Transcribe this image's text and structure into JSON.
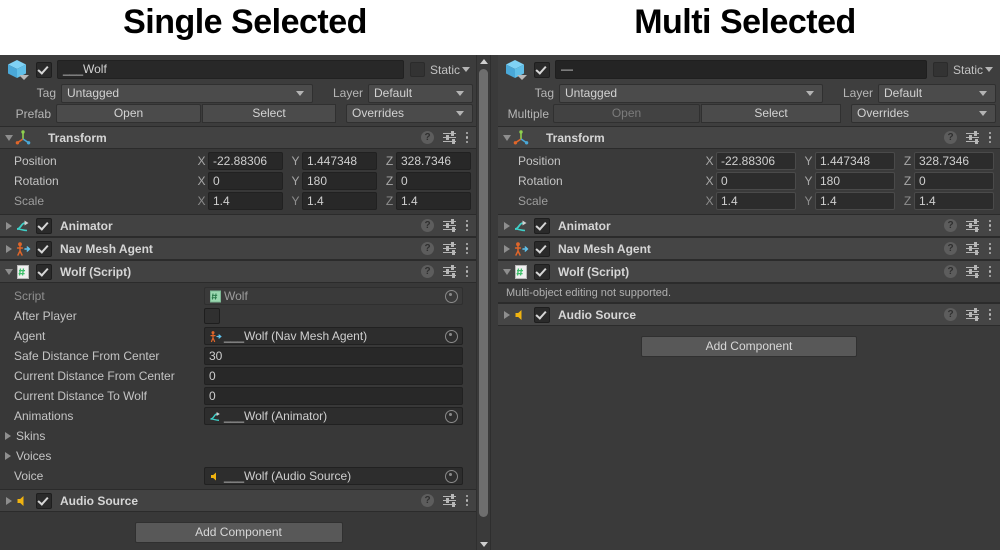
{
  "captions": {
    "left": "Single Selected",
    "right": "Multi Selected"
  },
  "colors": {
    "panel_bg": "#383838",
    "component_header": "#424242",
    "field_bg": "#282828",
    "text": "#c4c4c4",
    "gameobject_icon": "#5fc3ef",
    "navmesh_icon": "#e0662a",
    "script_icon": "#3fbf6b",
    "audio_icon": "#f0b310",
    "animator_icon": "#3fd0c8"
  },
  "single": {
    "name_field": {
      "value": "___Wolf",
      "placeholder": "Name",
      "enabled_checkbox": true
    },
    "static": {
      "label": "Static",
      "checked": false
    },
    "tag": {
      "label": "Tag",
      "value": "Untagged"
    },
    "layer": {
      "label": "Layer",
      "value": "Default"
    },
    "prefab": {
      "label": "Prefab",
      "open": "Open",
      "open_disabled": false,
      "select": "Select",
      "overrides": "Overrides"
    },
    "transform": {
      "title": "Transform",
      "expanded": true,
      "rows": [
        {
          "label": "Position",
          "dim": false,
          "x": "-22.88306",
          "y": "1.447348",
          "z": "328.7346"
        },
        {
          "label": "Rotation",
          "dim": false,
          "x": "0",
          "y": "180",
          "z": "0"
        },
        {
          "label": "Scale",
          "dim": true,
          "x": "1.4",
          "y": "1.4",
          "z": "1.4"
        }
      ],
      "axes": [
        "X",
        "Y",
        "Z"
      ]
    },
    "components": [
      {
        "title": "Animator",
        "icon": "animator-icon",
        "expanded": false,
        "enabled": true
      },
      {
        "title": "Nav Mesh Agent",
        "icon": "navmeshagent-icon",
        "expanded": false,
        "enabled": true
      },
      {
        "title": "Wolf (Script)",
        "icon": "script-icon",
        "expanded": true,
        "enabled": true
      }
    ],
    "script_props": [
      {
        "type": "object",
        "label": "Script",
        "dim": true,
        "readonly": true,
        "value": "Wolf",
        "icon": "script-asset-icon"
      },
      {
        "type": "checkbox",
        "label": "After Player",
        "checked": false
      },
      {
        "type": "object",
        "label": "Agent",
        "value": "___Wolf (Nav Mesh Agent)",
        "icon": "navmeshagent-icon"
      },
      {
        "type": "number",
        "label": "Safe Distance From Center",
        "value": "30"
      },
      {
        "type": "number",
        "label": "Current Distance From Center",
        "value": "0"
      },
      {
        "type": "number",
        "label": "Current Distance To Wolf",
        "value": "0"
      },
      {
        "type": "object",
        "label": "Animations",
        "value": "___Wolf (Animator)",
        "icon": "animator-icon"
      },
      {
        "type": "foldout",
        "label": "Skins"
      },
      {
        "type": "foldout",
        "label": "Voices"
      },
      {
        "type": "object",
        "label": "Voice",
        "value": "___Wolf (Audio Source)",
        "icon": "audio-icon"
      }
    ],
    "audio_component": {
      "title": "Audio Source",
      "icon": "audio-icon",
      "expanded": false,
      "enabled": true
    },
    "add_component": "Add Component",
    "scrollbar": {
      "visible": true
    }
  },
  "multi": {
    "name_field": {
      "value": "—",
      "placeholder": "Name",
      "enabled_checkbox": true
    },
    "static": {
      "label": "Static",
      "checked": false
    },
    "tag": {
      "label": "Tag",
      "value": "Untagged"
    },
    "layer": {
      "label": "Layer",
      "value": "Default"
    },
    "prefab": {
      "label": "Multiple",
      "open": "Open",
      "open_disabled": true,
      "select": "Select",
      "overrides": "Overrides"
    },
    "transform": {
      "title": "Transform",
      "expanded": true,
      "rows": [
        {
          "label": "Position",
          "dim": false,
          "x": "-22.88306",
          "y": "1.447348",
          "z": "328.7346"
        },
        {
          "label": "Rotation",
          "dim": false,
          "x": "0",
          "y": "180",
          "z": "0"
        },
        {
          "label": "Scale",
          "dim": true,
          "x": "1.4",
          "y": "1.4",
          "z": "1.4"
        }
      ],
      "axes": [
        "X",
        "Y",
        "Z"
      ]
    },
    "components": [
      {
        "title": "Animator",
        "icon": "animator-icon",
        "expanded": false,
        "enabled": true
      },
      {
        "title": "Nav Mesh Agent",
        "icon": "navmeshagent-icon",
        "expanded": false,
        "enabled": true
      },
      {
        "title": "Wolf (Script)",
        "icon": "script-icon",
        "expanded": true,
        "enabled": true
      }
    ],
    "notice": "Multi-object editing not supported.",
    "audio_component": {
      "title": "Audio Source",
      "icon": "audio-icon",
      "expanded": false,
      "enabled": true
    },
    "add_component": "Add Component",
    "scrollbar": {
      "visible": false
    }
  }
}
